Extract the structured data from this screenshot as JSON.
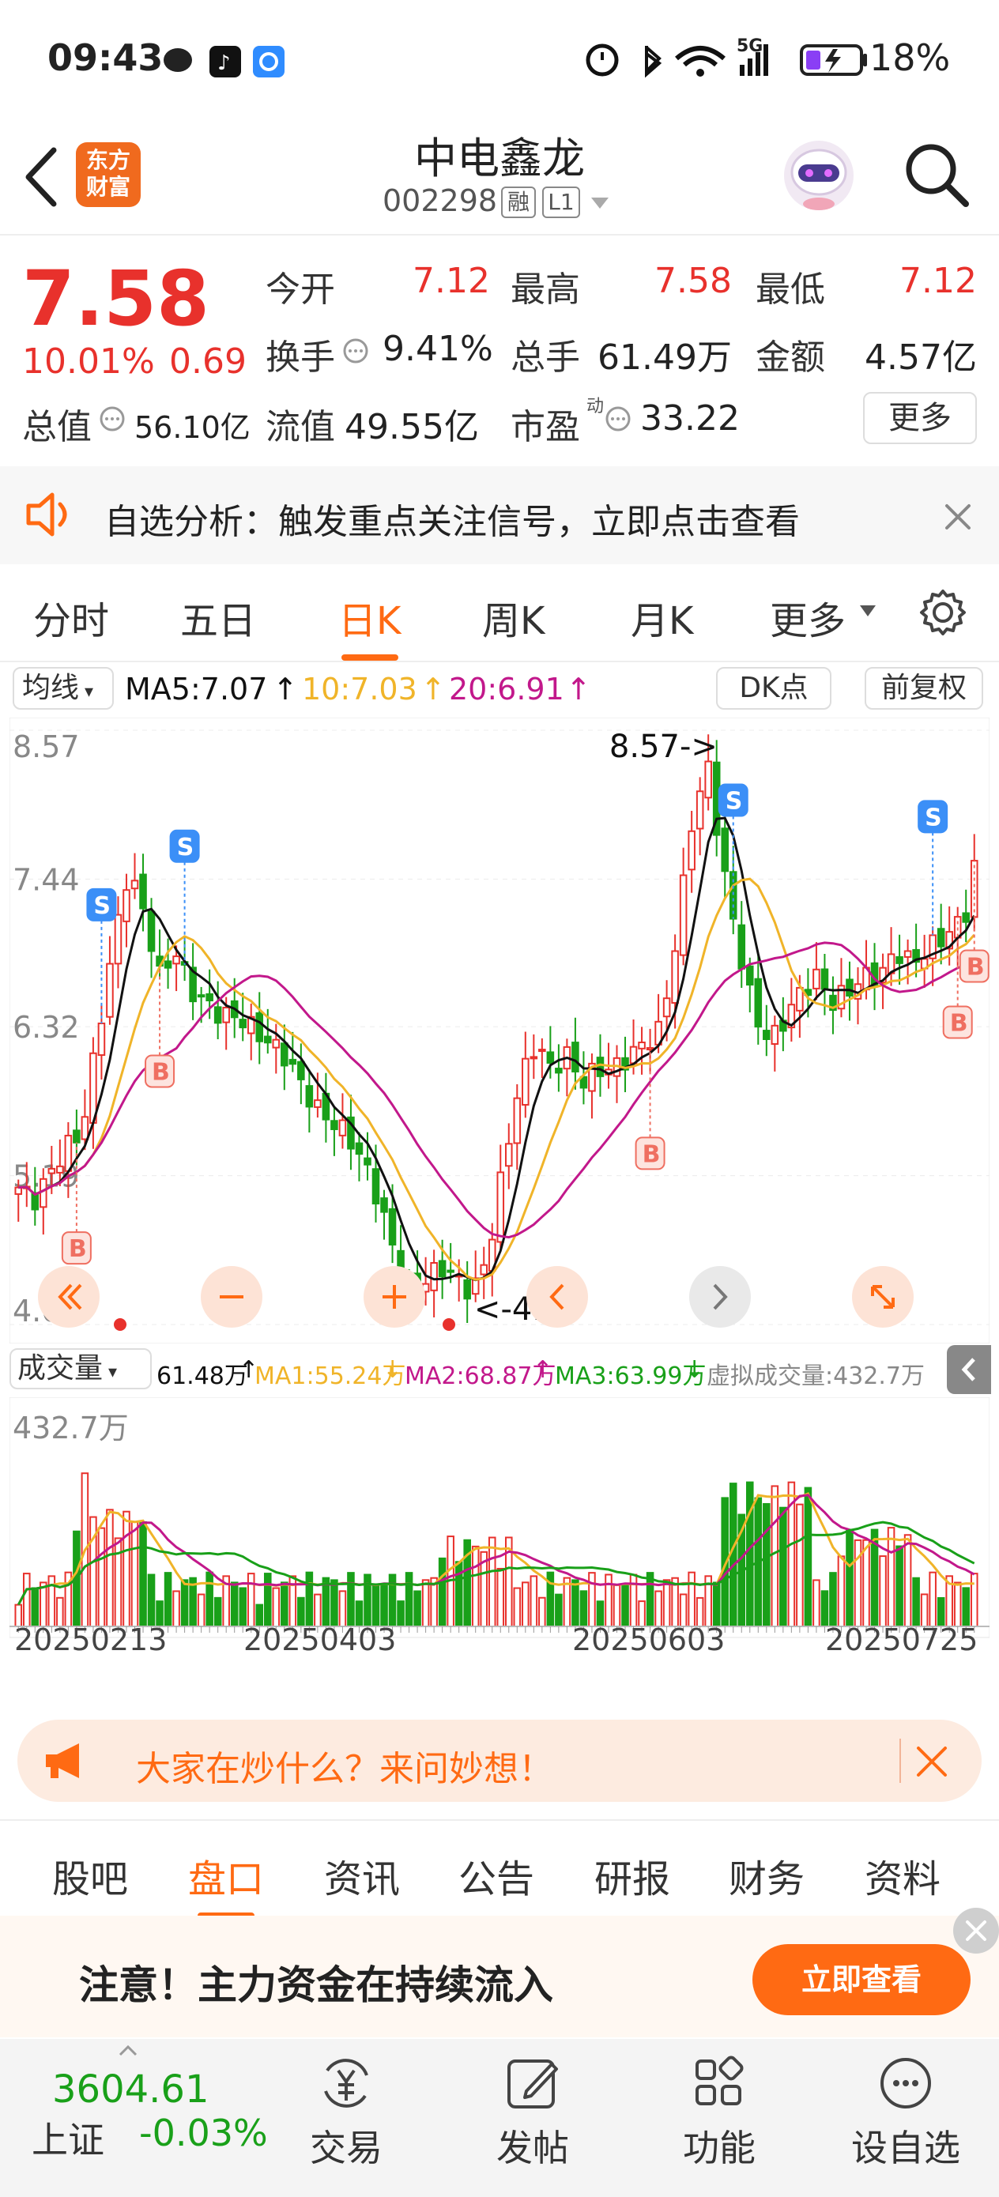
{
  "status_bar": {
    "time": "09:43",
    "network": "5G",
    "battery": "18%"
  },
  "header": {
    "stock_name": "中电鑫龙",
    "stock_code": "002298",
    "badge1": "融",
    "badge2": "L1",
    "logo_line1": "东方",
    "logo_line2": "财富"
  },
  "quote": {
    "price": "7.58",
    "change_pct": "10.01%",
    "change_amt": "0.69",
    "open_label": "今开",
    "open": "7.12",
    "high_label": "最高",
    "high": "7.58",
    "low_label": "最低",
    "low": "7.12",
    "turnover_label": "换手",
    "turnover": "9.41%",
    "volume_label": "总手",
    "volume": "61.49万",
    "amount_label": "金额",
    "amount": "4.57亿",
    "mktcap_label": "总值",
    "mktcap": "56.10亿",
    "float_label": "流值",
    "float_cap": "49.55亿",
    "pe_label": "市盈",
    "pe_sup": "动",
    "pe": "33.22",
    "more_button": "更多"
  },
  "notice": {
    "text": "自选分析：触发重点关注信号，立即点击查看"
  },
  "chart_tabs": [
    "分时",
    "五日",
    "日K",
    "周K",
    "月K",
    "更多"
  ],
  "active_tab": "日K",
  "ma_bar": {
    "selector": "均线",
    "ma5": "MA5:7.07",
    "ma10": "10:7.03",
    "ma20": "20:6.91",
    "dk_button": "DK点",
    "adjust_button": "前复权"
  },
  "volume_bar": {
    "selector": "成交量",
    "vol": "61.48万",
    "ma1": "MA1:55.24万",
    "ma2": "MA2:68.87万",
    "ma3": "MA3:63.99万",
    "virtual": "虚拟成交量:432.7万"
  },
  "chart_data": [
    {
      "type": "candlestick",
      "y_tick_labels": [
        "8.57",
        "7.44",
        "6.32",
        "5.19",
        "4.06"
      ],
      "ylim": [
        4.06,
        8.57
      ],
      "annotations": {
        "max": "8.57->",
        "min": "<-4.06"
      },
      "series": [
        {
          "name": "MA5",
          "color": "#111111"
        },
        {
          "name": "MA10",
          "color": "#f0b429"
        },
        {
          "name": "MA20",
          "color": "#c2188b"
        }
      ],
      "signals": [
        "S",
        "S",
        "S",
        "S",
        "B",
        "B",
        "B",
        "B",
        "B"
      ]
    },
    {
      "type": "bar",
      "y_tick_labels": [
        "432.7万"
      ],
      "x_tick_labels": [
        "20250213",
        "20250403",
        "20250603",
        "20250725"
      ]
    }
  ],
  "colors": {
    "up": "#e8312c",
    "down": "#19a019",
    "accent": "#ff6a13"
  },
  "promo": {
    "text": "大家在炒什么？来问妙想！"
  },
  "info_tabs": [
    "股吧",
    "盘口",
    "资讯",
    "公告",
    "研报",
    "财务",
    "资料"
  ],
  "active_info_tab": "盘口",
  "banner": {
    "text": "注意！主力资金在持续流入",
    "button": "立即查看"
  },
  "bottom_nav": {
    "index_value": "3604.61",
    "index_name": "上证",
    "index_change": "-0.03%",
    "items": [
      "交易",
      "发帖",
      "功能",
      "设自选"
    ]
  }
}
